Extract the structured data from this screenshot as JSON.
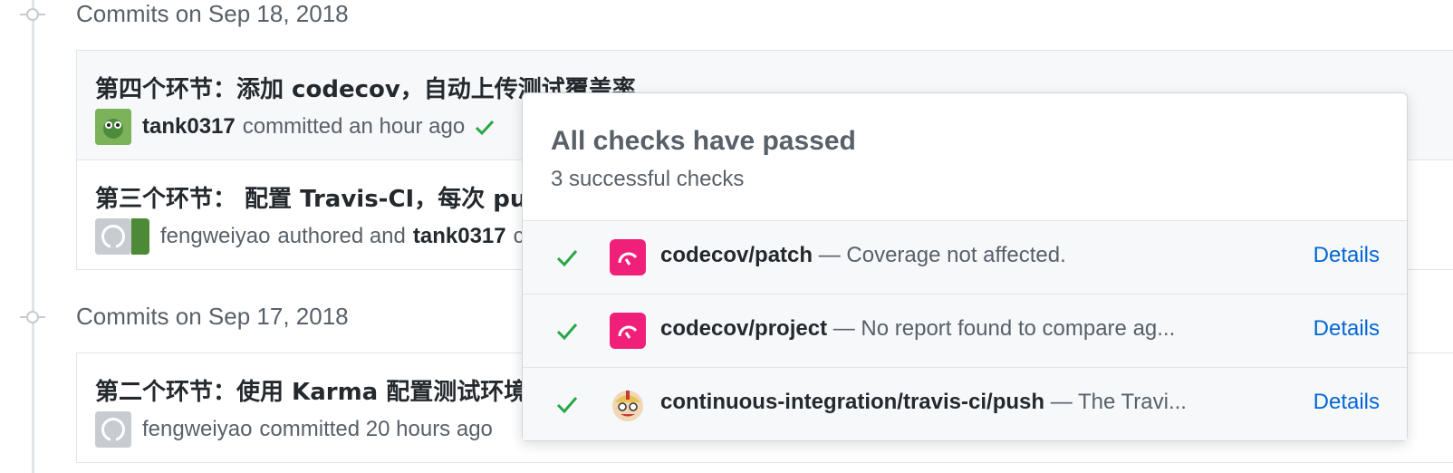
{
  "groups": [
    {
      "heading": "Commits on Sep 18, 2018",
      "commits": [
        {
          "title": "第四个环节：添加 codecov，自动上传测试覆盖率",
          "author": "tank0317",
          "action": "committed an hour ago",
          "status": "check-icon"
        },
        {
          "title": "第三个环节： 配置 Travis-CI，每次 pu",
          "author": "fengweiyao",
          "action": "authored and",
          "committer": "tank0317",
          "trailing": "c"
        }
      ]
    },
    {
      "heading": "Commits on Sep 17, 2018",
      "commits": [
        {
          "title": "第二个环节：使用 Karma 配置测试环境",
          "author": "fengweiyao",
          "action": "committed 20 hours ago"
        }
      ]
    }
  ],
  "popover": {
    "title": "All checks have passed",
    "subtitle": "3 successful checks",
    "checks": [
      {
        "name": "codecov/patch",
        "description": "— Coverage not affected.",
        "link": "Details",
        "icon": "codecov-icon"
      },
      {
        "name": "codecov/project",
        "description": "— No report found to compare ag...",
        "link": "Details",
        "icon": "codecov-icon"
      },
      {
        "name": "continuous-integration/travis-ci/push",
        "description": "— The Travi...",
        "link": "Details",
        "icon": "travis-icon"
      }
    ]
  },
  "colors": {
    "success": "#28a745",
    "link": "#0366d6",
    "codecov": "#f01f7a",
    "muted": "#586069"
  }
}
